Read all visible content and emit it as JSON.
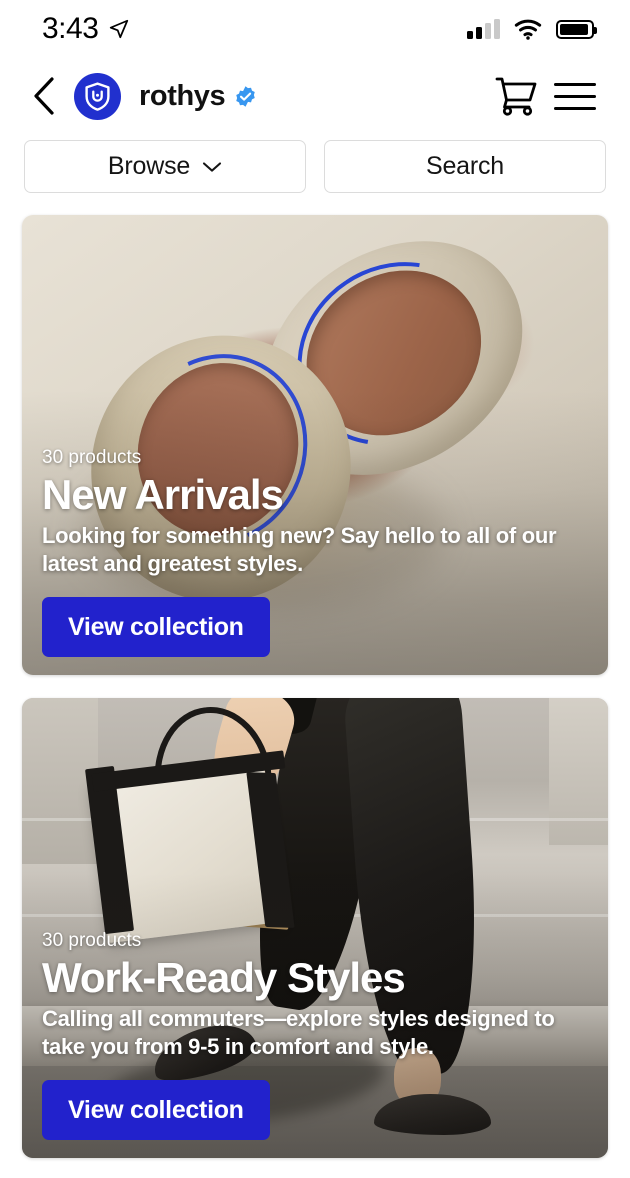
{
  "status_bar": {
    "time": "3:43",
    "location_icon": "location-arrow-icon",
    "signal_icon": "cellular-signal-icon",
    "wifi_icon": "wifi-icon",
    "battery_icon": "battery-icon"
  },
  "header": {
    "back_icon": "back-chevron-icon",
    "avatar_icon": "rothys-shield-logo",
    "shop_name": "rothys",
    "verified_icon": "verified-badge-icon",
    "cart_icon": "shopping-cart-icon",
    "menu_icon": "hamburger-menu-icon",
    "avatar_color": "#2130ce",
    "verified_color": "#3897f0"
  },
  "actions": {
    "browse_label": "Browse",
    "browse_chevron_icon": "chevron-down-icon",
    "search_label": "Search"
  },
  "colors": {
    "cta_blue": "#2222cc",
    "page_background": "#ffffff",
    "border_gray": "#dcdcdc"
  },
  "collections": [
    {
      "count": "30 products",
      "title": "New Arrivals",
      "description": "Looking for something new? Say hello to all of our latest and greatest styles.",
      "cta_label": "View collection",
      "image_alt": "beige knit ballet flats on cream background"
    },
    {
      "count": "30 products",
      "title": "Work-Ready Styles",
      "description": "Calling all commuters—explore styles designed to take you from 9-5 in comfort and style.",
      "cta_label": "View collection",
      "image_alt": "woman in black pants walking on sidewalk carrying a tote bag"
    }
  ]
}
